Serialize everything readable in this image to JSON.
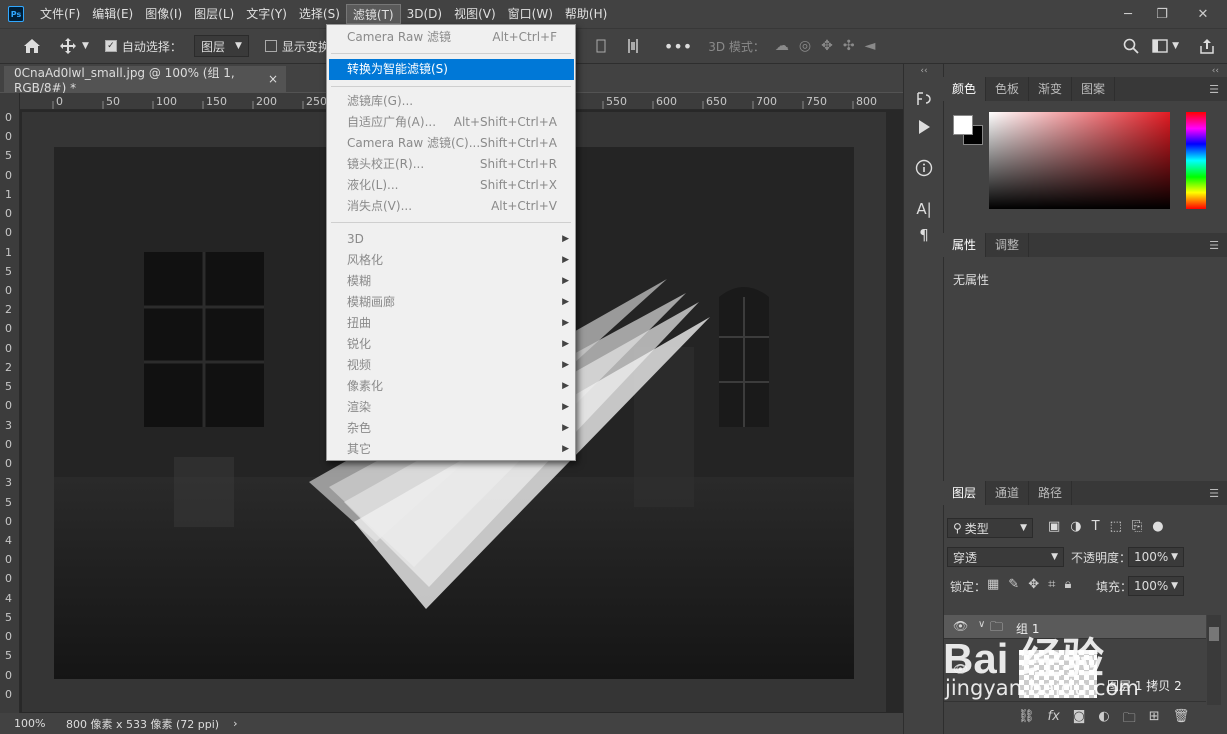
{
  "app": {
    "logo": "Ps"
  },
  "menubar": {
    "items": [
      "文件(F)",
      "编辑(E)",
      "图像(I)",
      "图层(L)",
      "文字(Y)",
      "选择(S)",
      "滤镜(T)",
      "3D(D)",
      "视图(V)",
      "窗口(W)",
      "帮助(H)"
    ],
    "active": "滤镜(T)"
  },
  "window_controls": {
    "minimize": "─",
    "restore": "❐",
    "close": "✕",
    "collapse": "‹‹"
  },
  "options": {
    "auto_select_label": "自动选择：",
    "auto_select_target": "图层",
    "show_transform_label": "显示变换控件",
    "mode_3d_label": "3D 模式："
  },
  "document": {
    "tab_title": "0CnaAd0lwl_small.jpg @ 100% (组 1, RGB/8#) *",
    "close": "×"
  },
  "ruler_h": [
    "0",
    "50",
    "100",
    "150",
    "200",
    "250",
    "550",
    "600",
    "650",
    "700",
    "750",
    "800"
  ],
  "ruler_v": [
    "0",
    "0",
    "5",
    "0",
    "1",
    "0",
    "0",
    "1",
    "5",
    "0",
    "2",
    "0",
    "0",
    "2",
    "5",
    "0",
    "3",
    "0",
    "0",
    "3",
    "5",
    "0",
    "4",
    "0",
    "0",
    "4",
    "5",
    "0",
    "5",
    "0",
    "0"
  ],
  "status": {
    "zoom": "100%",
    "doc_info": "800 像素 x 533 像素 (72 ppi)",
    "arrow": "›"
  },
  "filter_menu": {
    "items": [
      {
        "label": "Camera Raw 滤镜",
        "shortcut": "Alt+Ctrl+F"
      },
      {
        "label": "转换为智能滤镜(S)",
        "shortcut": "",
        "highlighted": true
      },
      {
        "label": "滤镜库(G)...",
        "shortcut": ""
      },
      {
        "label": "自适应广角(A)...",
        "shortcut": "Alt+Shift+Ctrl+A"
      },
      {
        "label": "Camera Raw 滤镜(C)...",
        "shortcut": "Shift+Ctrl+A"
      },
      {
        "label": "镜头校正(R)...",
        "shortcut": "Shift+Ctrl+R"
      },
      {
        "label": "液化(L)...",
        "shortcut": "Shift+Ctrl+X"
      },
      {
        "label": "消失点(V)...",
        "shortcut": "Alt+Ctrl+V"
      },
      {
        "label": "3D",
        "submenu": true
      },
      {
        "label": "风格化",
        "submenu": true
      },
      {
        "label": "模糊",
        "submenu": true
      },
      {
        "label": "模糊画廊",
        "submenu": true
      },
      {
        "label": "扭曲",
        "submenu": true
      },
      {
        "label": "锐化",
        "submenu": true
      },
      {
        "label": "视频",
        "submenu": true
      },
      {
        "label": "像素化",
        "submenu": true
      },
      {
        "label": "渲染",
        "submenu": true
      },
      {
        "label": "杂色",
        "submenu": true
      },
      {
        "label": "其它",
        "submenu": true
      }
    ]
  },
  "color_panel": {
    "tabs": [
      "颜色",
      "色板",
      "渐变",
      "图案"
    ],
    "active": "颜色",
    "hue_color": "#e21b23"
  },
  "properties_panel": {
    "tabs": [
      "属性",
      "调整"
    ],
    "active": "属性",
    "empty_text": "无属性"
  },
  "layers_panel": {
    "tabs": [
      "图层",
      "通道",
      "路径"
    ],
    "active": "图层",
    "filter_kind": "类型",
    "blend_mode": "穿透",
    "opacity_label": "不透明度：",
    "opacity_value": "100%",
    "lock_label": "锁定：",
    "fill_label": "填充：",
    "fill_value": "100%",
    "layers": [
      {
        "name": "组 1",
        "type": "group"
      },
      {
        "name": "图层 1 拷贝 2",
        "type": "layer"
      }
    ],
    "footer_fx": "fx"
  },
  "watermark": {
    "text": "Bai 经验",
    "subtext": "jingyan.baidu.com"
  }
}
